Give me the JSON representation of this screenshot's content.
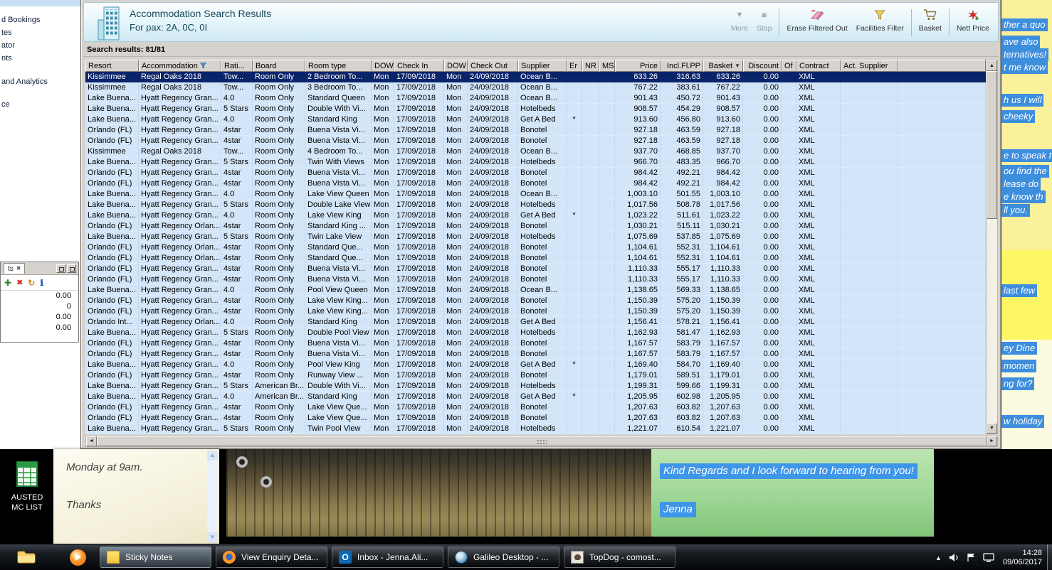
{
  "icons": {
    "more": "▼",
    "stop": "■",
    "sort_down": "▼",
    "scroll_up": "▲",
    "scroll_down": "▼",
    "scroll_left": "◄",
    "scroll_right": "►",
    "tray_arrow": "▲",
    "outlook_glyph": "O",
    "tab_close": "✖",
    "mini_add": "✚",
    "mini_delete": "✖",
    "mini_refresh": "↻",
    "mini_info": "ℹ"
  },
  "sidebar": {
    "items": [
      "d Bookings",
      "tes",
      "ator",
      "nts",
      "and Analytics",
      "ce"
    ]
  },
  "mini_panel": {
    "tab": "ts",
    "values": [
      "0.00",
      "0",
      "0.00",
      "0.00"
    ]
  },
  "window": {
    "title": "Accommodation Search Results",
    "subtitle": "For pax: 2A, 0C, 0I",
    "results_label": "Search results: 81/81",
    "toolbar": {
      "more": "More",
      "stop": "Stop",
      "erase": "Erase Filtered Out",
      "facilities": "Facilities Filter",
      "basket": "Basket",
      "nett": "Nett Price"
    }
  },
  "table": {
    "columns": [
      "Resort",
      "Accommodation",
      "Rati...",
      "Board",
      "Room type",
      "DOW",
      "Check In",
      "DOW",
      "Check Out",
      "Supplier",
      "Er",
      "NR",
      "MS",
      "Price",
      "Incl.Fl.PP",
      "Basket",
      "Discount",
      "Of",
      "Contract",
      "Act. Supplier"
    ],
    "rows": [
      [
        "Kissimmee",
        "Regal Oaks 2018",
        "Tow...",
        "Room Only",
        "2 Bedroom To...",
        "Mon",
        "17/09/2018",
        "Mon",
        "24/09/2018",
        "Ocean B...",
        "",
        "633.26",
        "316.63",
        "633.26",
        "0.00",
        "XML"
      ],
      [
        "Kissimmee",
        "Regal Oaks 2018",
        "Tow...",
        "Room Only",
        "3 Bedroom To...",
        "Mon",
        "17/09/2018",
        "Mon",
        "24/09/2018",
        "Ocean B...",
        "",
        "767.22",
        "383.61",
        "767.22",
        "0.00",
        "XML"
      ],
      [
        "Lake Buena...",
        "Hyatt Regency Gran...",
        "4.0",
        "Room Only",
        "Standard Queen",
        "Mon",
        "17/09/2018",
        "Mon",
        "24/09/2018",
        "Ocean B...",
        "",
        "901.43",
        "450.72",
        "901.43",
        "0.00",
        "XML"
      ],
      [
        "Lake Buena...",
        "Hyatt Regency Gran...",
        "5 Stars",
        "Room Only",
        "Double With Vi...",
        "Mon",
        "17/09/2018",
        "Mon",
        "24/09/2018",
        "Hotelbeds",
        "",
        "908.57",
        "454.29",
        "908.57",
        "0.00",
        "XML"
      ],
      [
        "Lake Buena...",
        "Hyatt Regency Gran...",
        "4.0",
        "Room Only",
        "Standard King",
        "Mon",
        "17/09/2018",
        "Mon",
        "24/09/2018",
        "Get A Bed",
        "*",
        "913.60",
        "456.80",
        "913.60",
        "0.00",
        "XML"
      ],
      [
        "Orlando (FL)",
        "Hyatt Regency Gran...",
        "4star",
        "Room Only",
        "Buena Vista Vi...",
        "Mon",
        "17/09/2018",
        "Mon",
        "24/09/2018",
        "Bonotel",
        "",
        "927.18",
        "463.59",
        "927.18",
        "0.00",
        "XML"
      ],
      [
        "Orlando (FL)",
        "Hyatt Regency Gran...",
        "4star",
        "Room Only",
        "Buena Vista Vi...",
        "Mon",
        "17/09/2018",
        "Mon",
        "24/09/2018",
        "Bonotel",
        "",
        "927.18",
        "463.59",
        "927.18",
        "0.00",
        "XML"
      ],
      [
        "Kissimmee",
        "Regal Oaks 2018",
        "Tow...",
        "Room Only",
        "4 Bedroom To...",
        "Mon",
        "17/09/2018",
        "Mon",
        "24/09/2018",
        "Ocean B...",
        "",
        "937.70",
        "468.85",
        "937.70",
        "0.00",
        "XML"
      ],
      [
        "Lake Buena...",
        "Hyatt Regency Gran...",
        "5 Stars",
        "Room Only",
        "Twin With Views",
        "Mon",
        "17/09/2018",
        "Mon",
        "24/09/2018",
        "Hotelbeds",
        "",
        "966.70",
        "483.35",
        "966.70",
        "0.00",
        "XML"
      ],
      [
        "Orlando (FL)",
        "Hyatt Regency Gran...",
        "4star",
        "Room Only",
        "Buena Vista Vi...",
        "Mon",
        "17/09/2018",
        "Mon",
        "24/09/2018",
        "Bonotel",
        "",
        "984.42",
        "492.21",
        "984.42",
        "0.00",
        "XML"
      ],
      [
        "Orlando (FL)",
        "Hyatt Regency Gran...",
        "4star",
        "Room Only",
        "Buena Vista Vi...",
        "Mon",
        "17/09/2018",
        "Mon",
        "24/09/2018",
        "Bonotel",
        "",
        "984.42",
        "492.21",
        "984.42",
        "0.00",
        "XML"
      ],
      [
        "Lake Buena...",
        "Hyatt Regency Gran...",
        "4.0",
        "Room Only",
        "Lake View Queen",
        "Mon",
        "17/09/2018",
        "Mon",
        "24/09/2018",
        "Ocean B...",
        "",
        "1,003.10",
        "501.55",
        "1,003.10",
        "0.00",
        "XML"
      ],
      [
        "Lake Buena...",
        "Hyatt Regency Gran...",
        "5 Stars",
        "Room Only",
        "Double Lake View",
        "Mon",
        "17/09/2018",
        "Mon",
        "24/09/2018",
        "Hotelbeds",
        "",
        "1,017.56",
        "508.78",
        "1,017.56",
        "0.00",
        "XML"
      ],
      [
        "Lake Buena...",
        "Hyatt Regency Gran...",
        "4.0",
        "Room Only",
        "Lake View King",
        "Mon",
        "17/09/2018",
        "Mon",
        "24/09/2018",
        "Get A Bed",
        "*",
        "1,023.22",
        "511.61",
        "1,023.22",
        "0.00",
        "XML"
      ],
      [
        "Orlando (FL)",
        "Hyatt Regency Orlan...",
        "4star",
        "Room Only",
        "Standard King ...",
        "Mon",
        "17/09/2018",
        "Mon",
        "24/09/2018",
        "Bonotel",
        "",
        "1,030.21",
        "515.11",
        "1,030.21",
        "0.00",
        "XML"
      ],
      [
        "Lake Buena...",
        "Hyatt Regency Gran...",
        "5 Stars",
        "Room Only",
        "Twin Lake View",
        "Mon",
        "17/09/2018",
        "Mon",
        "24/09/2018",
        "Hotelbeds",
        "",
        "1,075.69",
        "537.85",
        "1,075.69",
        "0.00",
        "XML"
      ],
      [
        "Orlando (FL)",
        "Hyatt Regency Orlan...",
        "4star",
        "Room Only",
        "Standard Que...",
        "Mon",
        "17/09/2018",
        "Mon",
        "24/09/2018",
        "Bonotel",
        "",
        "1,104.61",
        "552.31",
        "1,104.61",
        "0.00",
        "XML"
      ],
      [
        "Orlando (FL)",
        "Hyatt Regency Orlan...",
        "4star",
        "Room Only",
        "Standard Que...",
        "Mon",
        "17/09/2018",
        "Mon",
        "24/09/2018",
        "Bonotel",
        "",
        "1,104.61",
        "552.31",
        "1,104.61",
        "0.00",
        "XML"
      ],
      [
        "Orlando (FL)",
        "Hyatt Regency Gran...",
        "4star",
        "Room Only",
        "Buena Vista Vi...",
        "Mon",
        "17/09/2018",
        "Mon",
        "24/09/2018",
        "Bonotel",
        "",
        "1,110.33",
        "555.17",
        "1,110.33",
        "0.00",
        "XML"
      ],
      [
        "Orlando (FL)",
        "Hyatt Regency Gran...",
        "4star",
        "Room Only",
        "Buena Vista Vi...",
        "Mon",
        "17/09/2018",
        "Mon",
        "24/09/2018",
        "Bonotel",
        "",
        "1,110.33",
        "555.17",
        "1,110.33",
        "0.00",
        "XML"
      ],
      [
        "Lake Buena...",
        "Hyatt Regency Gran...",
        "4.0",
        "Room Only",
        "Pool View Queen",
        "Mon",
        "17/09/2018",
        "Mon",
        "24/09/2018",
        "Ocean B...",
        "",
        "1,138.65",
        "569.33",
        "1,138.65",
        "0.00",
        "XML"
      ],
      [
        "Orlando (FL)",
        "Hyatt Regency Gran...",
        "4star",
        "Room Only",
        "Lake View King...",
        "Mon",
        "17/09/2018",
        "Mon",
        "24/09/2018",
        "Bonotel",
        "",
        "1,150.39",
        "575.20",
        "1,150.39",
        "0.00",
        "XML"
      ],
      [
        "Orlando (FL)",
        "Hyatt Regency Gran...",
        "4star",
        "Room Only",
        "Lake View King...",
        "Mon",
        "17/09/2018",
        "Mon",
        "24/09/2018",
        "Bonotel",
        "",
        "1,150.39",
        "575.20",
        "1,150.39",
        "0.00",
        "XML"
      ],
      [
        "Orlando Int...",
        "Hyatt Regency Orlan...",
        "4.0",
        "Room Only",
        "Standard King",
        "Mon",
        "17/09/2018",
        "Mon",
        "24/09/2018",
        "Get A Bed",
        "",
        "1,156.41",
        "578.21",
        "1,156.41",
        "0.00",
        "XML"
      ],
      [
        "Lake Buena...",
        "Hyatt Regency Gran...",
        "5 Stars",
        "Room Only",
        "Double Pool View",
        "Mon",
        "17/09/2018",
        "Mon",
        "24/09/2018",
        "Hotelbeds",
        "",
        "1,162.93",
        "581.47",
        "1,162.93",
        "0.00",
        "XML"
      ],
      [
        "Orlando (FL)",
        "Hyatt Regency Gran...",
        "4star",
        "Room Only",
        "Buena Vista Vi...",
        "Mon",
        "17/09/2018",
        "Mon",
        "24/09/2018",
        "Bonotel",
        "",
        "1,167.57",
        "583.79",
        "1,167.57",
        "0.00",
        "XML"
      ],
      [
        "Orlando (FL)",
        "Hyatt Regency Gran...",
        "4star",
        "Room Only",
        "Buena Vista Vi...",
        "Mon",
        "17/09/2018",
        "Mon",
        "24/09/2018",
        "Bonotel",
        "",
        "1,167.57",
        "583.79",
        "1,167.57",
        "0.00",
        "XML"
      ],
      [
        "Lake Buena...",
        "Hyatt Regency Gran...",
        "4.0",
        "Room Only",
        "Pool View King",
        "Mon",
        "17/09/2018",
        "Mon",
        "24/09/2018",
        "Get A Bed",
        "*",
        "1,169.40",
        "584.70",
        "1,169.40",
        "0.00",
        "XML"
      ],
      [
        "Orlando (FL)",
        "Hyatt Regency Gran...",
        "4star",
        "Room Only",
        "Runway View ...",
        "Mon",
        "17/09/2018",
        "Mon",
        "24/09/2018",
        "Bonotel",
        "",
        "1,179.01",
        "589.51",
        "1,179.01",
        "0.00",
        "XML"
      ],
      [
        "Lake Buena...",
        "Hyatt Regency Gran...",
        "5 Stars",
        "American Br...",
        "Double With Vi...",
        "Mon",
        "17/09/2018",
        "Mon",
        "24/09/2018",
        "Hotelbeds",
        "",
        "1,199.31",
        "599.66",
        "1,199.31",
        "0.00",
        "XML"
      ],
      [
        "Lake Buena...",
        "Hyatt Regency Gran...",
        "4.0",
        "American Br...",
        "Standard King",
        "Mon",
        "17/09/2018",
        "Mon",
        "24/09/2018",
        "Get A Bed",
        "*",
        "1,205.95",
        "602.98",
        "1,205.95",
        "0.00",
        "XML"
      ],
      [
        "Orlando (FL)",
        "Hyatt Regency Gran...",
        "4star",
        "Room Only",
        "Lake View Que...",
        "Mon",
        "17/09/2018",
        "Mon",
        "24/09/2018",
        "Bonotel",
        "",
        "1,207.63",
        "603.82",
        "1,207.63",
        "0.00",
        "XML"
      ],
      [
        "Orlando (FL)",
        "Hyatt Regency Gran...",
        "4star",
        "Room Only",
        "Lake View Que...",
        "Mon",
        "17/09/2018",
        "Mon",
        "24/09/2018",
        "Bonotel",
        "",
        "1,207.63",
        "603.82",
        "1,207.63",
        "0.00",
        "XML"
      ],
      [
        "Lake Buena...",
        "Hyatt Regency Gran...",
        "5 Stars",
        "Room Only",
        "Twin Pool View",
        "Mon",
        "17/09/2018",
        "Mon",
        "24/09/2018",
        "Hotelbeds",
        "",
        "1,221.07",
        "610.54",
        "1,221.07",
        "0.00",
        "XML"
      ]
    ]
  },
  "right_notes": {
    "fragments": [
      "ther a quo",
      "ave also",
      "ternatives!",
      "t me know",
      "h us I will",
      "cheeky",
      "e to speak t",
      "ou find the",
      "lease do",
      "e know th",
      "ll you.",
      "last few",
      "ey Dine",
      "momen",
      "ng for?",
      "w holiday"
    ]
  },
  "desktop_icon": {
    "line1": "AUSTED",
    "line2": "MC LIST"
  },
  "sticky_note": {
    "line1": "Monday at 9am.",
    "line2": "Thanks"
  },
  "green_panel": {
    "message": "Kind Regards and I look forward to hearing from you!",
    "signature": "Jenna"
  },
  "taskbar": {
    "buttons": [
      "Sticky Notes",
      "View Enquiry Deta...",
      "Inbox - Jenna.Ali...",
      "Galileo Desktop - ...",
      "TopDog - comost..."
    ],
    "time": "14:28",
    "date": "09/06/2017"
  }
}
